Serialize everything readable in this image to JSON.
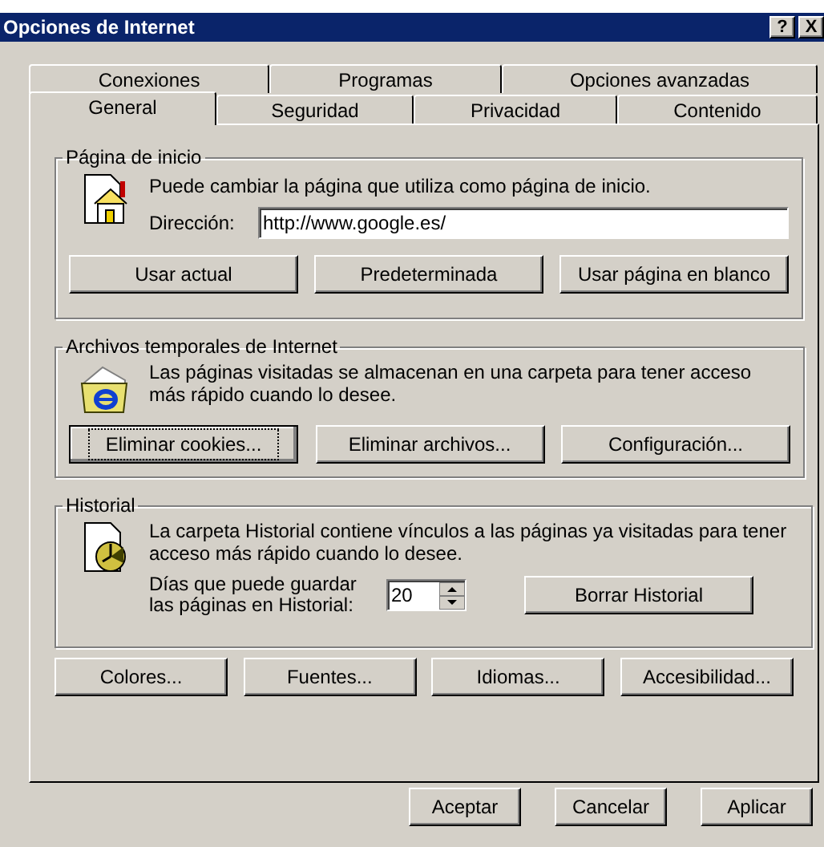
{
  "window": {
    "title": "Opciones de Internet",
    "controls": [
      "?",
      "X"
    ]
  },
  "tab_rows": [
    [
      {
        "label": "Conexiones",
        "selected": false
      },
      {
        "label": "Programas",
        "selected": false
      },
      {
        "label": "Opciones avanzadas",
        "selected": false
      }
    ],
    [
      {
        "label": "General",
        "selected": true
      },
      {
        "label": "Seguridad",
        "selected": false
      },
      {
        "label": "Privacidad",
        "selected": false
      },
      {
        "label": "Contenido",
        "selected": false
      }
    ]
  ],
  "home_page": {
    "title": "Página de inicio",
    "description": "Puede cambiar la página que utiliza como página de inicio.",
    "address_label": "Dirección:",
    "address_value": "http://www.google.es/",
    "buttons": [
      {
        "label": "Usar actual",
        "focused": false
      },
      {
        "label": "Predeterminada",
        "focused": false
      },
      {
        "label": "Usar página en blanco",
        "focused": false
      }
    ]
  },
  "temp_files": {
    "title": "Archivos temporales de Internet",
    "description": "Las páginas visitadas se almacenan en una carpeta para tener acceso más rápido cuando lo desee.",
    "buttons": [
      {
        "label": "Eliminar cookies...",
        "focused": true
      },
      {
        "label": "Eliminar archivos...",
        "focused": false
      },
      {
        "label": "Configuración...",
        "focused": false
      }
    ]
  },
  "history": {
    "title": "Historial",
    "description": "La carpeta Historial contiene vínculos a las páginas ya visitadas para tener acceso más rápido cuando lo desee.",
    "days_label": "Días que puede guardar las páginas en Historial:",
    "days_value": "20",
    "button": "Borrar Historial"
  },
  "extra_buttons": [
    "Colores...",
    "Fuentes...",
    "Idiomas...",
    "Accesibilidad..."
  ],
  "dialog_buttons": [
    "Aceptar",
    "Cancelar",
    "Aplicar"
  ]
}
